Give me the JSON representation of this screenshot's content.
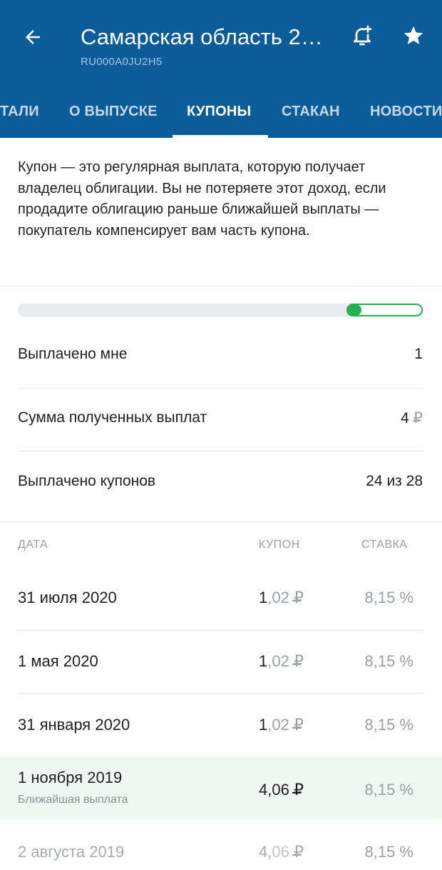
{
  "header": {
    "title": "Самарская область 2…",
    "isin": "RU000A0JU2H5"
  },
  "tabs": [
    {
      "label": "ТАЛИ"
    },
    {
      "label": "О ВЫПУСКЕ"
    },
    {
      "label": "КУПОНЫ"
    },
    {
      "label": "СТАКАН"
    },
    {
      "label": "НОВОСТИ"
    }
  ],
  "intro_text": "Купон — это регулярная выплата, которую получает владелец облигации. Вы не потеряете этот доход, если продадите облигацию раньше ближайшей выплаты — покупатель компенсирует вам часть купона.",
  "progress": {
    "paid": 24,
    "total": 28,
    "color": "#22b14c"
  },
  "summary": [
    {
      "label": "Выплачено мне",
      "value": "1"
    },
    {
      "label": "Сумма полученных выплат",
      "value": "4",
      "currency": "₽"
    },
    {
      "label": "Выплачено купонов",
      "value": "24 из 28"
    }
  ],
  "table": {
    "headers": {
      "date": "ДАТА",
      "coupon": "КУПОН",
      "rate": "СТАВКА"
    },
    "rows": [
      {
        "date": "31 июля 2020",
        "coupon_int": "1",
        "coupon_frac": ",02",
        "currency": "₽",
        "rate": "8,15 %"
      },
      {
        "date": "1 мая 2020",
        "coupon_int": "1",
        "coupon_frac": ",02",
        "currency": "₽",
        "rate": "8,15 %"
      },
      {
        "date": "31 января 2020",
        "coupon_int": "1",
        "coupon_frac": ",02",
        "currency": "₽",
        "rate": "8,15 %"
      },
      {
        "date": "1 ноября 2019",
        "note": "Ближайшая выплата",
        "coupon_int": "4,06",
        "coupon_frac": "",
        "currency": "₽",
        "rate": "8,15 %"
      },
      {
        "date": "2 августа 2019",
        "coupon_int": "4,",
        "coupon_frac": "06",
        "currency": "₽",
        "rate": "8,15 %"
      }
    ]
  },
  "colors": {
    "header_bg": "#0b5c99",
    "accent_green": "#22b14c",
    "highlight_bg": "#eef8f0"
  },
  "icons": {
    "back": "arrow-left-icon",
    "bell": "bell-add-icon",
    "star": "star-icon"
  }
}
